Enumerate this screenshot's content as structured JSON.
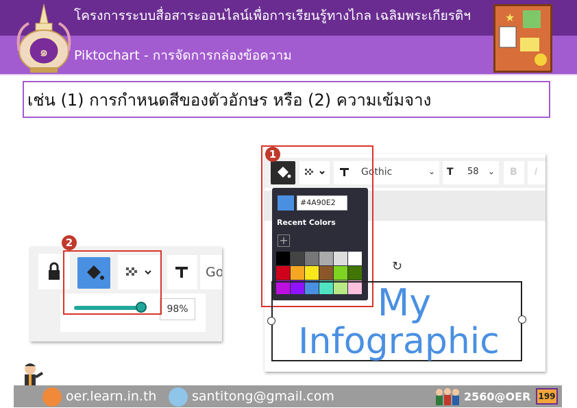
{
  "header": {
    "title": "โครงการระบบสื่อสาระออนไลน์เพื่อการเรียนรู้ทางไกล เฉลิมพระเกียรติฯ",
    "subtitle": "Piktochart - การจัดการกล่องข้อความ"
  },
  "heading": "เช่น (1) การกำหนดสีของตัวอักษร หรือ (2) ความเข้มจาง",
  "panel2": {
    "badge": "2",
    "font_partial": "Go",
    "opacity_value": "98%",
    "opacity_level": 0.98
  },
  "panel1": {
    "badge": "1",
    "font_name": "Gothic",
    "font_size": "58",
    "bold_label": "B",
    "italic_label": "I",
    "picker": {
      "hex": "#4A90E2",
      "recent_label": "Recent Colors",
      "add_label": "+",
      "colors": [
        "#000000",
        "#444444",
        "#777777",
        "#aaaaaa",
        "#dddddd",
        "#ffffff",
        "#d0021b",
        "#f5a623",
        "#f8e71c",
        "#8b572a",
        "#7ed321",
        "#417505",
        "#bd10e0",
        "#9013fe",
        "#4a90e2",
        "#50e3c2",
        "#b8e986",
        "#ffc0e0"
      ]
    },
    "canvas_text_line1": "My",
    "canvas_text_line2": "Infographic"
  },
  "footer": {
    "website": "oer.learn.in.th",
    "email": "santitong@gmail.com",
    "code": "2560@OER",
    "page": "199"
  }
}
